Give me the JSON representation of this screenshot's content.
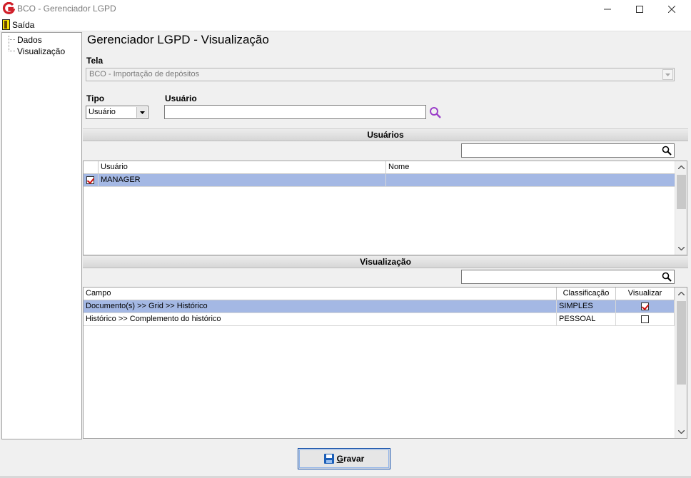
{
  "window": {
    "title": "BCO - Gerenciador LGPD"
  },
  "menu": {
    "exit_label": "Saída"
  },
  "tree": {
    "items": [
      {
        "label": "Dados"
      },
      {
        "label": "Visualização"
      }
    ]
  },
  "page": {
    "title": "Gerenciador LGPD - Visualização"
  },
  "form": {
    "screen_label": "Tela",
    "screen_value": "BCO - Importação de depósitos",
    "type_label": "Tipo",
    "type_value": "Usuário",
    "user_label": "Usuário",
    "user_value": ""
  },
  "users_section": {
    "title": "Usuários",
    "search_value": "",
    "columns": [
      "Usuário",
      "Nome"
    ],
    "rows": [
      {
        "checked": true,
        "usuario": "MANAGER",
        "nome": "",
        "selected": true
      }
    ]
  },
  "view_section": {
    "title": "Visualização",
    "search_value": "",
    "columns": [
      "Campo",
      "Classificação",
      "Visualizar"
    ],
    "rows": [
      {
        "campo": "Documento(s) >> Grid >> Histórico",
        "classificacao": "SIMPLES",
        "visualizar": true,
        "selected": true
      },
      {
        "campo": "Histórico >> Complemento do histórico",
        "classificacao": "PESSOAL",
        "visualizar": false,
        "selected": false
      }
    ]
  },
  "actions": {
    "save_label": "Gravar"
  },
  "colors": {
    "selection": "#a4b8e4",
    "logo_red": "#d0202a",
    "search_purple": "#9b3fc9",
    "save_border": "#0a4aa8"
  }
}
